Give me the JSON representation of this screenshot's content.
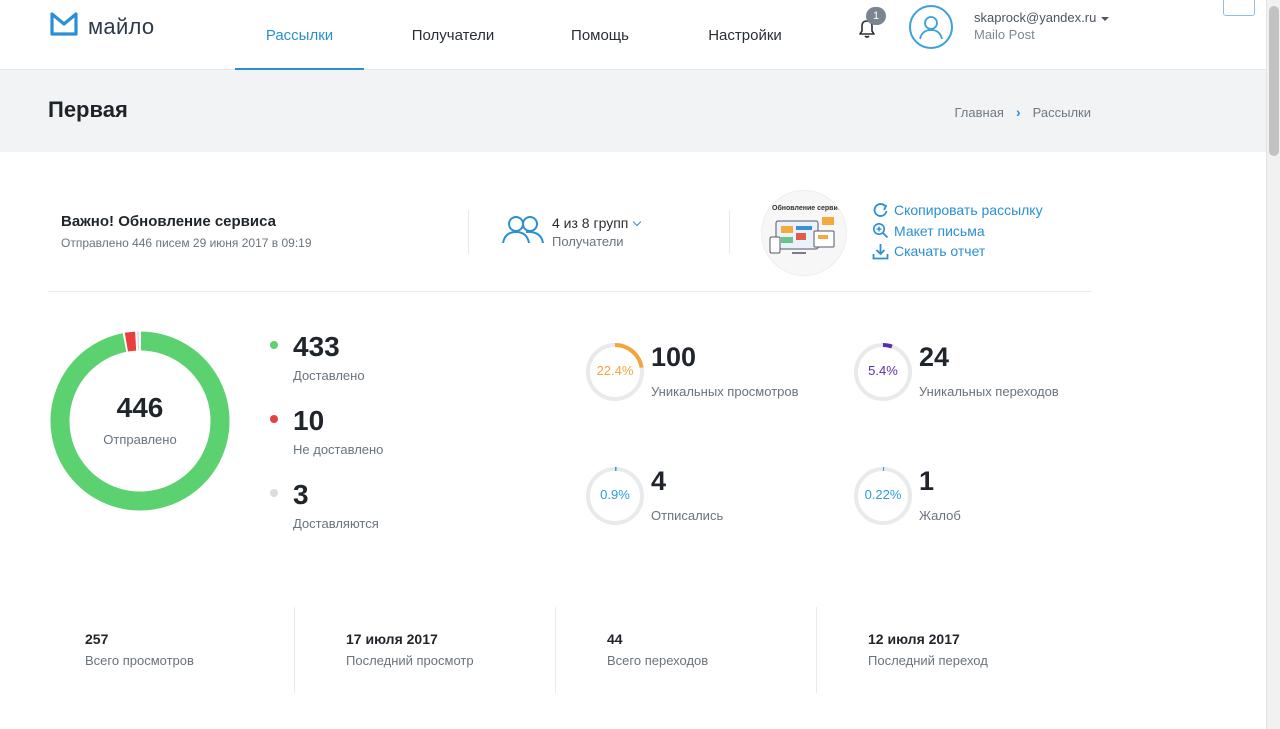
{
  "header": {
    "logo_text": "майло",
    "nav": [
      {
        "label": "Рассылки",
        "active": true
      },
      {
        "label": "Получатели",
        "active": false
      },
      {
        "label": "Помощь",
        "active": false
      },
      {
        "label": "Настройки",
        "active": false
      }
    ],
    "notifications_count": "1",
    "user_email": "skaprock@yandex.ru",
    "user_company": "Mailo Post"
  },
  "title_bar": {
    "title": "Первая",
    "breadcrumb": [
      "Главная",
      "Рассылки"
    ]
  },
  "campaign": {
    "name": "Важно! Обновление сервиса",
    "sent_info": "Отправлено 446 писем 29 июня 2017 в 09:19",
    "groups_count": "4 из 8 групп",
    "groups_label": "Получатели",
    "thumbnail_title": "Обновление сервиса",
    "actions": [
      {
        "label": "Скопировать рассылку",
        "icon": "refresh-icon"
      },
      {
        "label": "Макет письма",
        "icon": "zoom-in-icon"
      },
      {
        "label": "Скачать отчет",
        "icon": "download-icon"
      }
    ]
  },
  "delivery": {
    "total": "446",
    "total_label": "Отправлено",
    "items": [
      {
        "value": "433",
        "label": "Доставлено",
        "color": "#5cd170"
      },
      {
        "value": "10",
        "label": "Не доставлено",
        "color": "#e8403f"
      },
      {
        "value": "3",
        "label": "Доставляются",
        "color": "#dcdcdc"
      }
    ]
  },
  "metrics": [
    {
      "percent_text": "22.4%",
      "percent": 22.4,
      "value": "100",
      "label": "Уникальных просмотров",
      "color": "#f3a53c"
    },
    {
      "percent_text": "5.4%",
      "percent": 5.4,
      "value": "24",
      "label": "Уникальных переходов",
      "color": "#5c2ea6"
    },
    {
      "percent_text": "0.9%",
      "percent": 0.9,
      "value": "4",
      "label": "Отписались",
      "color": "#2aa0d8"
    },
    {
      "percent_text": "0.22%",
      "percent": 0.22,
      "value": "1",
      "label": "Жалоб",
      "color": "#2aa0d8"
    }
  ],
  "summary": [
    {
      "value": "257",
      "label": "Всего просмотров"
    },
    {
      "value": "17 июля 2017",
      "label": "Последний просмотр"
    },
    {
      "value": "44",
      "label": "Всего переходов"
    },
    {
      "value": "12 июля 2017",
      "label": "Последний переход"
    }
  ]
}
